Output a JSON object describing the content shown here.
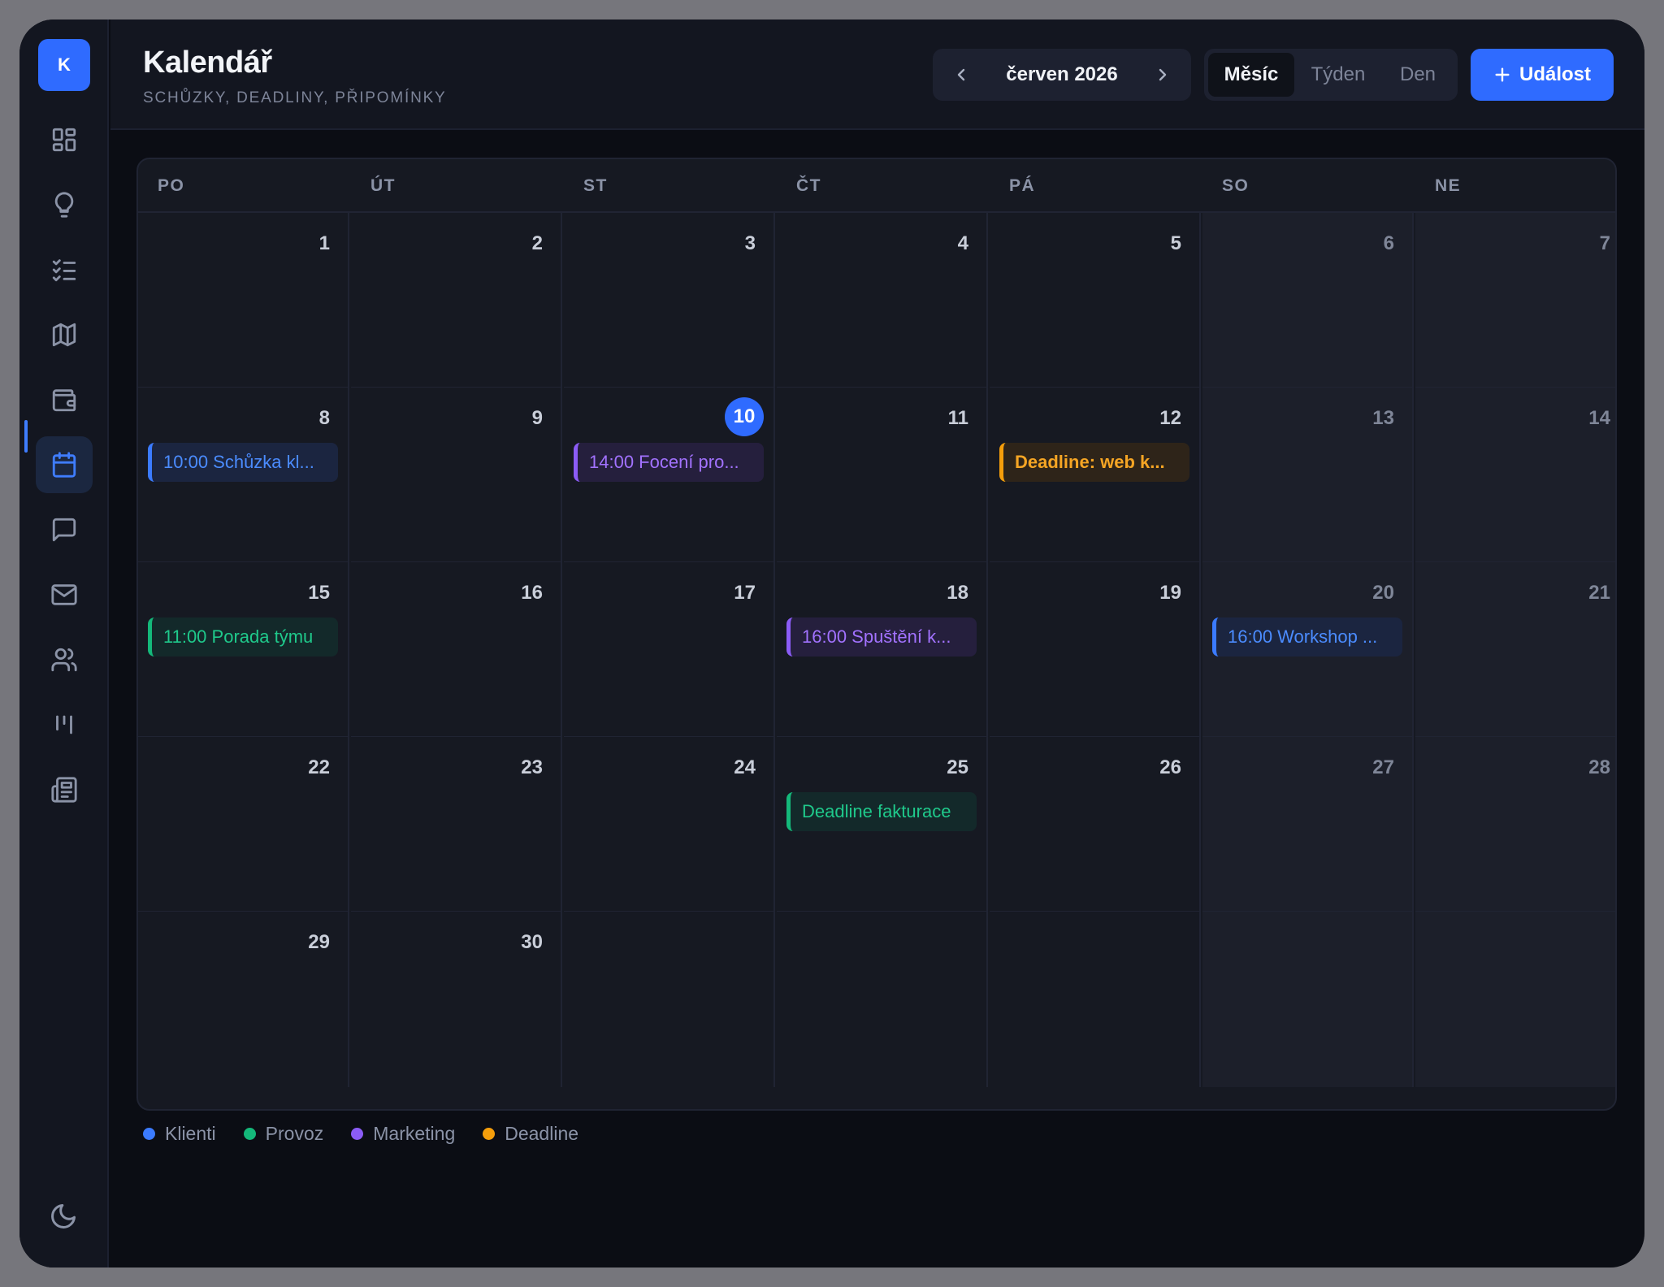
{
  "app": {
    "logo_letter": "K"
  },
  "header": {
    "title": "Kalendář",
    "subtitle": "SCHŮZKY, DEADLINY, PŘIPOMÍNKY",
    "month": "červen 2026",
    "views": [
      "Měsíc",
      "Týden",
      "Den"
    ],
    "active_view": "Měsíc",
    "add_label": "Událost"
  },
  "sidebar": {
    "items": [
      {
        "icon": "dashboard-icon"
      },
      {
        "icon": "lightbulb-icon"
      },
      {
        "icon": "checklist-icon"
      },
      {
        "icon": "map-icon"
      },
      {
        "icon": "wallet-icon"
      },
      {
        "icon": "calendar-icon",
        "active": true
      },
      {
        "icon": "chat-icon"
      },
      {
        "icon": "mail-icon"
      },
      {
        "icon": "users-icon"
      },
      {
        "icon": "kanban-icon"
      },
      {
        "icon": "newspaper-icon"
      }
    ],
    "theme_icon": "moon-icon"
  },
  "calendar": {
    "weekdays": [
      "PO",
      "ÚT",
      "ST",
      "ČT",
      "PÁ",
      "SO",
      "NE"
    ],
    "today": 10,
    "weeks": [
      [
        {
          "day": "1"
        },
        {
          "day": "2"
        },
        {
          "day": "3"
        },
        {
          "day": "4"
        },
        {
          "day": "5"
        },
        {
          "day": "6"
        },
        {
          "day": "7"
        }
      ],
      [
        {
          "day": "8",
          "event": {
            "text": "10:00 Schůzka kl...",
            "category": "Klienti"
          }
        },
        {
          "day": "9"
        },
        {
          "day": "10",
          "event": {
            "text": "14:00 Focení pro...",
            "category": "Marketing"
          }
        },
        {
          "day": "11"
        },
        {
          "day": "12",
          "event": {
            "text": "Deadline: web k...",
            "category": "Deadline"
          }
        },
        {
          "day": "13"
        },
        {
          "day": "14"
        }
      ],
      [
        {
          "day": "15",
          "event": {
            "text": "11:00 Porada týmu",
            "category": "Provoz"
          }
        },
        {
          "day": "16"
        },
        {
          "day": "17"
        },
        {
          "day": "18",
          "event": {
            "text": "16:00 Spuštění k...",
            "category": "Marketing"
          }
        },
        {
          "day": "19"
        },
        {
          "day": "20",
          "event": {
            "text": "16:00 Workshop ...",
            "category": "Klienti"
          }
        },
        {
          "day": "21"
        }
      ],
      [
        {
          "day": "22"
        },
        {
          "day": "23"
        },
        {
          "day": "24"
        },
        {
          "day": "25",
          "event": {
            "text": "Deadline fakturace",
            "category": "Provoz"
          }
        },
        {
          "day": "26"
        },
        {
          "day": "27"
        },
        {
          "day": "28"
        }
      ],
      [
        {
          "day": "29"
        },
        {
          "day": "30"
        },
        {
          "day": ""
        },
        {
          "day": ""
        },
        {
          "day": ""
        },
        {
          "day": ""
        },
        {
          "day": ""
        }
      ]
    ]
  },
  "legend": [
    {
      "label": "Klienti",
      "color": "#3b7bff"
    },
    {
      "label": "Provoz",
      "color": "#14b87a"
    },
    {
      "label": "Marketing",
      "color": "#8b5cf6"
    },
    {
      "label": "Deadline",
      "color": "#f59e0b"
    }
  ]
}
